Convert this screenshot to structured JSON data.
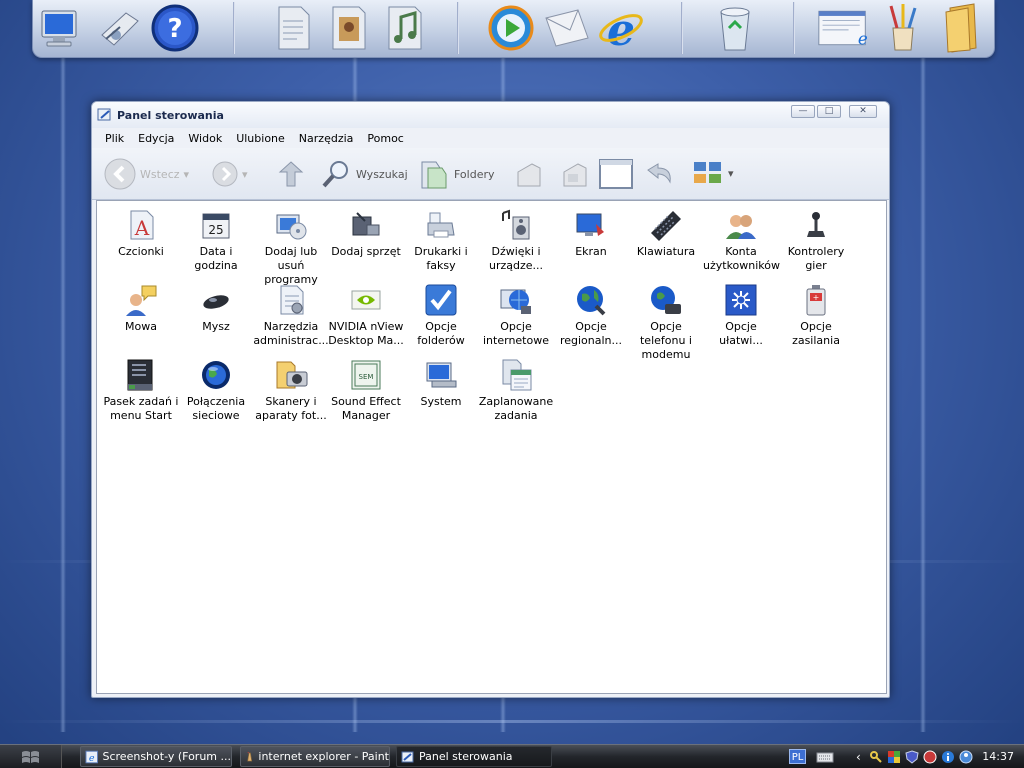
{
  "window": {
    "title": "Panel sterowania",
    "controls": {
      "minimize": "—",
      "maximize": "□",
      "close": "✕"
    }
  },
  "menu": [
    "Plik",
    "Edycja",
    "Widok",
    "Ulubione",
    "Narzędzia",
    "Pomoc"
  ],
  "toolbar": {
    "back": "Wstecz",
    "search": "Wyszukaj",
    "folders": "Foldery"
  },
  "items": [
    {
      "label": "Czcionki",
      "icon": "fonts-icon"
    },
    {
      "label": "Data i godzina",
      "icon": "calendar-icon"
    },
    {
      "label": "Dodaj lub usuń programy",
      "icon": "add-remove-programs-icon"
    },
    {
      "label": "Dodaj sprzęt",
      "icon": "add-hardware-icon"
    },
    {
      "label": "Drukarki i faksy",
      "icon": "printer-icon"
    },
    {
      "label": "Dźwięki i urządze...",
      "icon": "speaker-icon"
    },
    {
      "label": "Ekran",
      "icon": "display-icon"
    },
    {
      "label": "Klawiatura",
      "icon": "keyboard-icon"
    },
    {
      "label": "Konta użytkowników",
      "icon": "users-icon"
    },
    {
      "label": "Kontrolery gier",
      "icon": "joystick-icon"
    },
    {
      "label": "Mowa",
      "icon": "speech-icon"
    },
    {
      "label": "Mysz",
      "icon": "mouse-icon"
    },
    {
      "label": "Narzędzia administrac...",
      "icon": "admin-tools-icon"
    },
    {
      "label": "NVIDIA nView Desktop Ma...",
      "icon": "nvidia-icon"
    },
    {
      "label": "Opcje folderów",
      "icon": "folder-options-icon"
    },
    {
      "label": "Opcje internetowe",
      "icon": "internet-options-icon"
    },
    {
      "label": "Opcje regionaln...",
      "icon": "globe-icon"
    },
    {
      "label": "Opcje telefonu i modemu",
      "icon": "phone-modem-icon"
    },
    {
      "label": "Opcje ułatwi...",
      "icon": "accessibility-icon"
    },
    {
      "label": "Opcje zasilania",
      "icon": "battery-icon"
    },
    {
      "label": "Pasek zadań i menu Start",
      "icon": "taskbar-icon"
    },
    {
      "label": "Połączenia sieciowe",
      "icon": "network-icon"
    },
    {
      "label": "Skanery i aparaty fot...",
      "icon": "scanner-camera-icon"
    },
    {
      "label": "Sound Effect Manager",
      "icon": "sound-effect-icon"
    },
    {
      "label": "System",
      "icon": "system-icon"
    },
    {
      "label": "Zaplanowane zadania",
      "icon": "scheduled-tasks-icon"
    }
  ],
  "taskbar": {
    "tasks": [
      {
        "label": "Screenshot-y (Forum ...",
        "icon": "ie-icon"
      },
      {
        "label": "internet explorer - Paint",
        "icon": "paint-icon"
      },
      {
        "label": "Panel sterowania",
        "icon": "control-panel-icon",
        "active": true
      }
    ],
    "language": "PL",
    "clock": "14:37"
  },
  "dock": {
    "icons": [
      "my-computer-icon",
      "control-panel-icon",
      "help-icon",
      "documents-icon",
      "pictures-icon",
      "music-icon",
      "media-player-icon",
      "mail-icon",
      "internet-explorer-icon",
      "recycle-bin-icon",
      "web-page-icon",
      "paint-brushes-icon",
      "folder-icon"
    ]
  },
  "calendar_day": "25"
}
